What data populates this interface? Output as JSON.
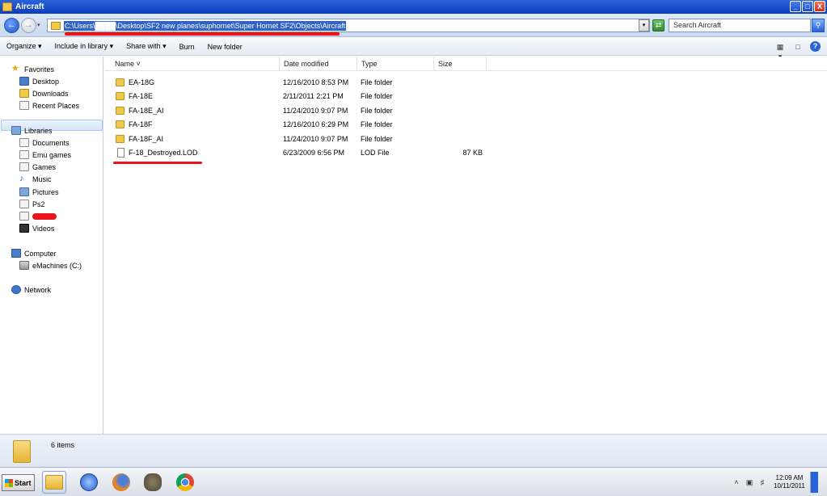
{
  "window": {
    "title": "Aircraft"
  },
  "titlebar_buttons": [
    "_",
    "□",
    "X"
  ],
  "address": {
    "path": "C:\\Users\\████\\Desktop\\SF2 new planes\\suphornet\\Super Hornet SF2\\Objects\\Aircraft"
  },
  "search": {
    "placeholder": "Search Aircraft"
  },
  "toolbar": {
    "organize": "Organize ▾",
    "include_in_library": "Include in library ▾",
    "share_with": "Share with ▾",
    "burn": "Burn",
    "new_folder": "New folder"
  },
  "nav": {
    "favorites": "Favorites",
    "desktop": "Desktop",
    "downloads": "Downloads",
    "recent_places": "Recent Places",
    "libraries": "Libraries",
    "documents": "Documents",
    "emu_games": "Emu games",
    "games": "Games",
    "music": "Music",
    "pictures": "Pictures",
    "ps2": "Ps2",
    "videos": "Videos",
    "computer": "Computer",
    "drive_c": "eMachines (C:)",
    "network": "Network"
  },
  "columns": {
    "name": "Name",
    "date_modified": "Date modified",
    "type": "Type",
    "size": "Size"
  },
  "files": [
    {
      "name": "EA-18G",
      "date": "12/16/2010 8:53 PM",
      "type": "File folder",
      "size": "",
      "kind": "folder"
    },
    {
      "name": "FA-18E",
      "date": "2/11/2011 2:21 PM",
      "type": "File folder",
      "size": "",
      "kind": "folder"
    },
    {
      "name": "FA-18E_AI",
      "date": "11/24/2010 9:07 PM",
      "type": "File folder",
      "size": "",
      "kind": "folder"
    },
    {
      "name": "FA-18F",
      "date": "12/16/2010 6:29 PM",
      "type": "File folder",
      "size": "",
      "kind": "folder"
    },
    {
      "name": "FA-18F_AI",
      "date": "11/24/2010 9:07 PM",
      "type": "File folder",
      "size": "",
      "kind": "folder"
    },
    {
      "name": "F-18_Destroyed.LOD",
      "date": "6/23/2009 6:56 PM",
      "type": "LOD File",
      "size": "87 KB",
      "kind": "file"
    }
  ],
  "details": {
    "item_count": "6 items"
  },
  "taskbar": {
    "start": "Start"
  },
  "clock": {
    "time": "12:09 AM",
    "date": "10/11/2011"
  },
  "colors": {
    "title_bar": "#0a3ec0",
    "selection": "#3163c5",
    "annotation_red": "#e8141a"
  }
}
